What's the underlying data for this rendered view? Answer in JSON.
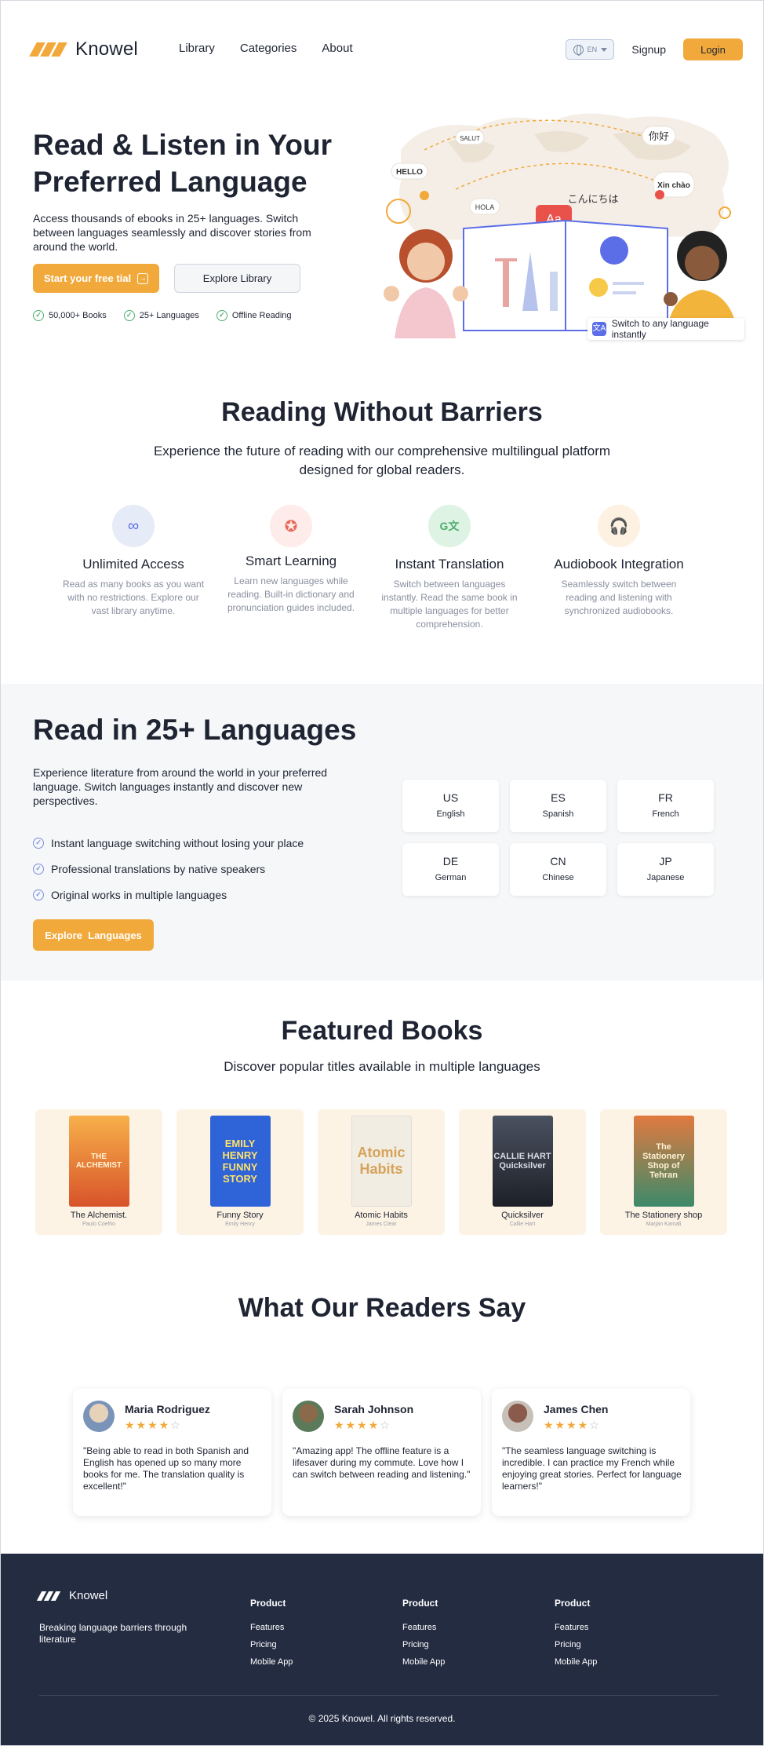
{
  "nav": {
    "brand": "Knowel",
    "links": [
      "Library",
      "Categories",
      "About"
    ],
    "language_code": "EN",
    "signup": "Signup",
    "login": "Login"
  },
  "hero": {
    "title": "Read & Listen in Your Preferred Language",
    "description": "Access thousands of ebooks in 25+ languages. Switch between languages seamlessly and discover stories from around the world.",
    "primary_cta": "Start your free tial",
    "secondary_cta": "Explore Library",
    "stats": [
      "50,000+ Books",
      "25+ Languages",
      "Offline Reading"
    ],
    "illustration_words": [
      "SALUT",
      "你好",
      "HELLO",
      "HOLA",
      "こんにちは",
      "Xin chào",
      "Aa"
    ],
    "illustration_caption": "Switch to any language instantly"
  },
  "barriers": {
    "title": "Reading Without Barriers",
    "subtitle": "Experience the future of reading with our comprehensive multilingual platform designed for global readers.",
    "features": [
      {
        "title": "Unlimited Access",
        "description": "Read as many books as you want with no restrictions. Explore our vast library anytime.",
        "icon": "infinity-icon",
        "color": "#5b6ee8",
        "bg": "#e6ebf8"
      },
      {
        "title": "Smart Learning",
        "description": "Learn new languages while reading. Built-in dictionary and pronunciation guides included.",
        "icon": "award-icon",
        "color": "#e86a5b",
        "bg": "#fdecea"
      },
      {
        "title": "Instant Translation",
        "description": "Switch between languages instantly. Read the same book in multiple languages for better comprehension.",
        "icon": "translate-icon",
        "color": "#4caf6e",
        "bg": "#dff3e4"
      },
      {
        "title": "Audiobook Integration",
        "description": "Seamlessly switch between reading and listening with synchronized audiobooks.",
        "icon": "headphones-icon",
        "color": "#f2a93b",
        "bg": "#fdf1e2"
      }
    ]
  },
  "languages": {
    "title": "Read in 25+ Languages",
    "description": "Experience literature from around the world in your preferred language. Switch languages instantly and discover new perspectives.",
    "points": [
      "Instant language switching without losing your place",
      "Professional translations by native speakers",
      "Original works in multiple languages"
    ],
    "cta": "Explore  Languages",
    "cards": [
      {
        "code": "US",
        "name": "English"
      },
      {
        "code": "ES",
        "name": "Spanish"
      },
      {
        "code": "FR",
        "name": "French"
      },
      {
        "code": "DE",
        "name": "German"
      },
      {
        "code": "CN",
        "name": "Chinese"
      },
      {
        "code": "JP",
        "name": "Japanese"
      }
    ]
  },
  "books": {
    "title": "Featured Books",
    "subtitle": "Discover popular titles available in multiple languages",
    "items": [
      {
        "title": "The Alchemist.",
        "author": "Paulo Coelho",
        "cover_text": "THE ALCHEMIST",
        "cover_bg": "#e8752a",
        "cover_fg": "#fff4d6"
      },
      {
        "title": "Funny Story",
        "author": "Emily Henry",
        "cover_text": "EMILY HENRY FUNNY STORY",
        "cover_bg": "#2f63d8",
        "cover_fg": "#ffe26a"
      },
      {
        "title": "Atomic Habits",
        "author": "James Clear",
        "cover_text": "Atomic Habits",
        "cover_bg": "#f1ede2",
        "cover_fg": "#d7a25a"
      },
      {
        "title": "Quicksilver",
        "author": "Callie Hart",
        "cover_text": "CALLIE HART Quicksilver",
        "cover_bg": "#2b2f36",
        "cover_fg": "#d8dde6"
      },
      {
        "title": "The Stationery shop",
        "author": "Marjan Kamali",
        "cover_text": "The Stationery Shop of Tehran",
        "cover_bg": "#d9653a",
        "cover_fg": "#fff0d4"
      }
    ]
  },
  "testimonials": {
    "title": "What Our Readers Say",
    "items": [
      {
        "name": "Maria Rodriguez",
        "rating": 4,
        "quote": "\"Being able to read in both Spanish and English has opened up so many more books for me. The translation quality is excellent!\"",
        "avatar_color": "#c7b49a"
      },
      {
        "name": "Sarah Johnson",
        "rating": 4,
        "quote": "\"Amazing app! The offline feature is a lifesaver during my commute. Love how I can switch between reading and listening.\"",
        "avatar_color": "#8a6a4a"
      },
      {
        "name": "James Chen",
        "rating": 4,
        "quote": "\"The seamless language switching is incredible. I can practice my French while enjoying great stories. Perfect for language learners!\"",
        "avatar_color": "#6a4a3a"
      }
    ]
  },
  "footer": {
    "brand": "Knowel",
    "tagline": "Breaking language barriers through literature",
    "columns": [
      {
        "title": "Product",
        "links": [
          "Features",
          "Pricing",
          "Mobile App"
        ]
      },
      {
        "title": "Product",
        "links": [
          "Features",
          "Pricing",
          "Mobile App"
        ]
      },
      {
        "title": "Product",
        "links": [
          "Features",
          "Pricing",
          "Mobile App"
        ]
      }
    ],
    "copyright": "© 2025 Knowel. All rights reserved."
  },
  "colors": {
    "accent": "#f2a93b",
    "footer_bg": "#242c42",
    "section_bg": "#f5f7f9",
    "book_card_bg": "#fdf3e4"
  }
}
